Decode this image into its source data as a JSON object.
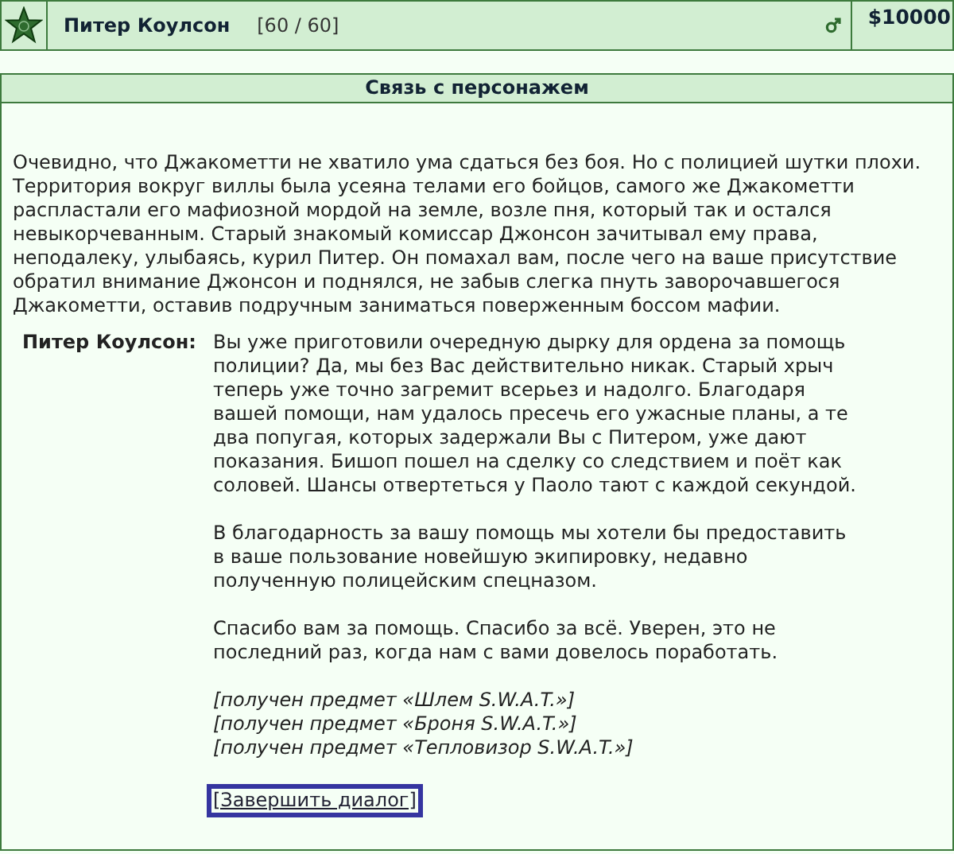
{
  "character": {
    "name": "Питер Коулсон",
    "health": "[60 / 60]",
    "money": "$10000"
  },
  "panel": {
    "title": "Связь с персонажем",
    "narrative": "Очевидно, что Джакометти не хватило ума сдаться без боя. Но с полицией шутки плохи. Территория вокруг виллы была усеяна телами его бойцов, самого же Джакометти распластали его мафиозной мордой на земле, возле пня, который так и остался невыкорчеванным. Старый знакомый комиссар Джонсон зачитывал ему права, неподалеку, улыбаясь, курил Питер. Он помахал вам, после чего на ваше присутствие обратил внимание Джонсон и поднялся, не забыв слегка пнуть заворочавшегося Джакометти, оставив подручным заниматься поверженным боссом мафии.",
    "speaker": "Питер Коулсон:",
    "paragraphs": [
      "Вы уже приготовили очередную дырку для ордена за помощь полиции? Да, мы без Вас действительно никак. Старый хрыч теперь уже точно загремит всерьез и надолго. Благодаря вашей помощи, нам удалось пресечь его ужасные планы, а те два попугая, которых задержали Вы с Питером, уже дают показания. Бишоп пошел на сделку со следствием и поёт как соловей. Шансы отвертеться у Паоло тают с каждой секундой.",
      "В благодарность за вашу помощь мы хотели бы предоставить в ваше пользование новейшую экипировку, недавно полученную полицейским спецназом.",
      "Спасибо вам за помощь. Спасибо за всё. Уверен, это не последний раз, когда нам с вами довелось поработать."
    ],
    "items": [
      "[получен предмет «Шлем S.W.A.T.»]",
      "[получен предмет «Броня S.W.A.T.»]",
      "[получен предмет «Тепловизор S.W.A.T.»]"
    ],
    "action": {
      "label": "[Завершить диалог]",
      "focused": true
    }
  }
}
